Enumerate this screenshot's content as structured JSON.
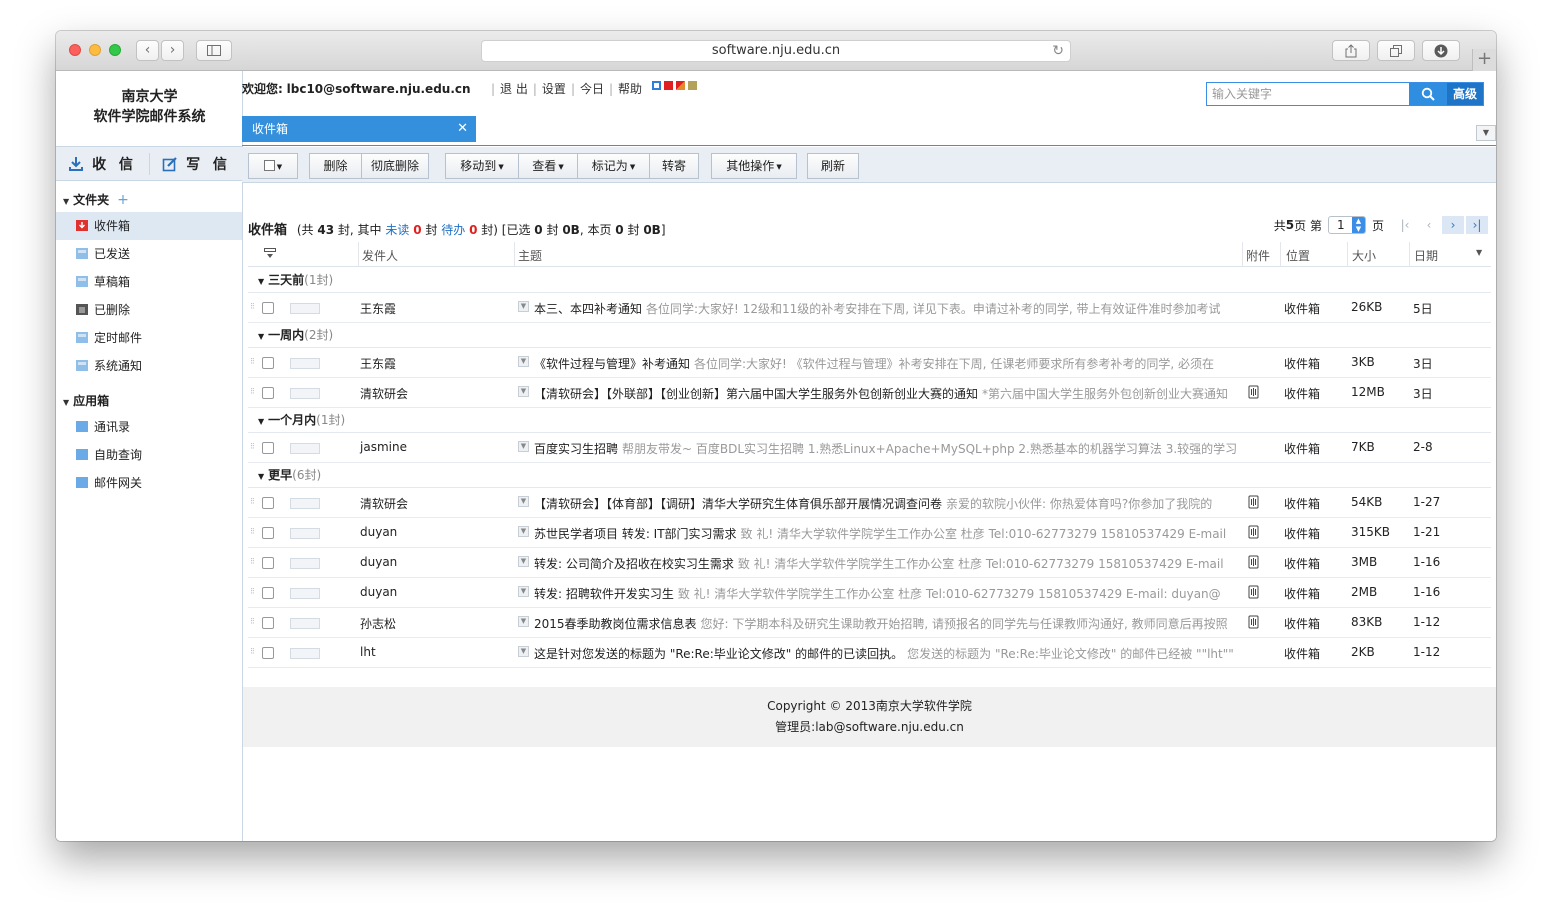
{
  "browser": {
    "url": "software.nju.edu.cn",
    "colors": {
      "close": "#fc605c",
      "minimize": "#fdbc40",
      "zoom": "#34c84a"
    }
  },
  "logo": {
    "line1": "南京大学",
    "line2": "软件学院邮件系统"
  },
  "actions": {
    "receive": "收 信",
    "compose": "写 信"
  },
  "header": {
    "welcome_prefix": "欢迎您:",
    "user": "lbc10@software.nju.edu.cn",
    "links": [
      "退 出",
      "设置",
      "今日",
      "帮助"
    ],
    "skin_colors": [
      "#2f7fd9",
      "#e02020",
      "#e24a1e",
      "#b5a25a"
    ],
    "search_placeholder": "输入关键字",
    "advanced": "高级"
  },
  "tab": {
    "label": "收件箱"
  },
  "sidebar": {
    "folders_title": "文件夹",
    "folders": [
      {
        "label": "收件箱",
        "icon": "inbox-icon",
        "color": "#e03131"
      },
      {
        "label": "已发送",
        "icon": "folder-icon",
        "color": "#8fbfe8"
      },
      {
        "label": "草稿箱",
        "icon": "folder-icon",
        "color": "#8fbfe8"
      },
      {
        "label": "已删除",
        "icon": "trash-icon",
        "color": "#555555"
      },
      {
        "label": "定时邮件",
        "icon": "folder-icon",
        "color": "#8fbfe8"
      },
      {
        "label": "系统通知",
        "icon": "folder-icon",
        "color": "#8fbfe8"
      }
    ],
    "apps_title": "应用箱",
    "apps": [
      {
        "label": "通讯录",
        "color": "#6aaae6"
      },
      {
        "label": "自助查询",
        "color": "#6aaae6"
      },
      {
        "label": "邮件网关",
        "color": "#6aaae6"
      }
    ]
  },
  "toolbar": {
    "delete": "删除",
    "delete_forever": "彻底删除",
    "move_to": "移动到",
    "view": "查看",
    "mark_as": "标记为",
    "forward": "转寄",
    "more": "其他操作",
    "refresh": "刷新"
  },
  "status": {
    "title": "收件箱",
    "total_pre": "(共",
    "total": "43",
    "mid1": "封, 其中",
    "unread_label": "未读",
    "unread": "0",
    "mid2": "封",
    "todo_label": "待办",
    "todo": "0",
    "selected_text": "封) [已选",
    "selected": "0",
    "selected_size_pre": "封",
    "selected_size": "0B",
    "page_pre": ", 本页",
    "page_count": "0",
    "page_size_pre": "封",
    "page_size": "0B",
    "close": "]"
  },
  "pager": {
    "total_pre": "共",
    "total_pages": "5",
    "total_post": "页 第",
    "current": "1",
    "post": "页"
  },
  "columns": {
    "sender": "发件人",
    "subject": "主题",
    "attach": "附件",
    "location": "位置",
    "size": "大小",
    "date": "日期"
  },
  "groups": [
    {
      "label": "三天前",
      "count": "(1封)",
      "rows": [
        {
          "sender": "王东霞",
          "subject": "本三、本四补考通知",
          "preview": "各位同学:大家好! 12级和11级的补考安排在下周, 详见下表。申请过补考的同学, 带上有效证件准时参加考试",
          "attach": false,
          "location": "收件箱",
          "size": "26KB",
          "date": "5日"
        }
      ]
    },
    {
      "label": "一周内",
      "count": "(2封)",
      "rows": [
        {
          "sender": "王东霞",
          "subject": "《软件过程与管理》补考通知",
          "preview": "各位同学:大家好! 《软件过程与管理》补考安排在下周, 任课老师要求所有参考补考的同学, 必须在",
          "attach": false,
          "location": "收件箱",
          "size": "3KB",
          "date": "3日"
        },
        {
          "sender": "清软研会",
          "subject": "【清软研会】【外联部】【创业创新】第六届中国大学生服务外包创新创业大赛的通知",
          "preview": "*第六届中国大学生服务外包创新创业大赛通知",
          "attach": true,
          "location": "收件箱",
          "size": "12MB",
          "date": "3日"
        }
      ]
    },
    {
      "label": "一个月内",
      "count": "(1封)",
      "rows": [
        {
          "sender": "jasmine",
          "subject": "百度实习生招聘",
          "preview": "帮朋友带发~ 百度BDL实习生招聘 1.熟悉Linux+Apache+MySQL+php 2.熟悉基本的机器学习算法 3.较强的学习",
          "attach": false,
          "location": "收件箱",
          "size": "7KB",
          "date": "2-8"
        }
      ]
    },
    {
      "label": "更早",
      "count": "(6封)",
      "rows": [
        {
          "sender": "清软研会",
          "subject": "【清软研会】【体育部】【调研】清华大学研究生体育俱乐部开展情况调查问卷",
          "preview": "亲爱的软院小伙伴: 你热爱体育吗?你参加了我院的",
          "attach": true,
          "location": "收件箱",
          "size": "54KB",
          "date": "1-27"
        },
        {
          "sender": "duyan",
          "subject": "苏世民学者项目 转发: IT部门实习需求",
          "preview": "致 礼! 清华大学软件学院学生工作办公室 杜彦 Tel:010-62773279 15810537429 E-mail",
          "attach": true,
          "location": "收件箱",
          "size": "315KB",
          "date": "1-21"
        },
        {
          "sender": "duyan",
          "subject": "转发: 公司简介及招收在校实习生需求",
          "preview": "致 礼! 清华大学软件学院学生工作办公室 杜彦 Tel:010-62773279 15810537429 E-mail",
          "attach": true,
          "location": "收件箱",
          "size": "3MB",
          "date": "1-16"
        },
        {
          "sender": "duyan",
          "subject": "转发: 招聘软件开发实习生",
          "preview": "致 礼! 清华大学软件学院学生工作办公室 杜彦 Tel:010-62773279 15810537429 E-mail: duyan@",
          "attach": true,
          "location": "收件箱",
          "size": "2MB",
          "date": "1-16"
        },
        {
          "sender": "孙志松",
          "subject": "2015春季助教岗位需求信息表",
          "preview": "您好: 下学期本科及研究生课助教开始招聘, 请预报名的同学先与任课教师沟通好, 教师同意后再按照",
          "attach": true,
          "location": "收件箱",
          "size": "83KB",
          "date": "1-12"
        },
        {
          "sender": "lht",
          "subject": "这是针对您发送的标题为 \"Re:Re:毕业论文修改\" 的邮件的已读回执。",
          "preview": "您发送的标题为 \"Re:Re:毕业论文修改\" 的邮件已经被 \"\"lht\"\"",
          "attach": false,
          "location": "收件箱",
          "size": "2KB",
          "date": "1-12"
        }
      ]
    }
  ],
  "footer": {
    "copyright": "Copyright © 2013南京大学软件学院",
    "admin": "管理员:lab@software.nju.edu.cn"
  }
}
